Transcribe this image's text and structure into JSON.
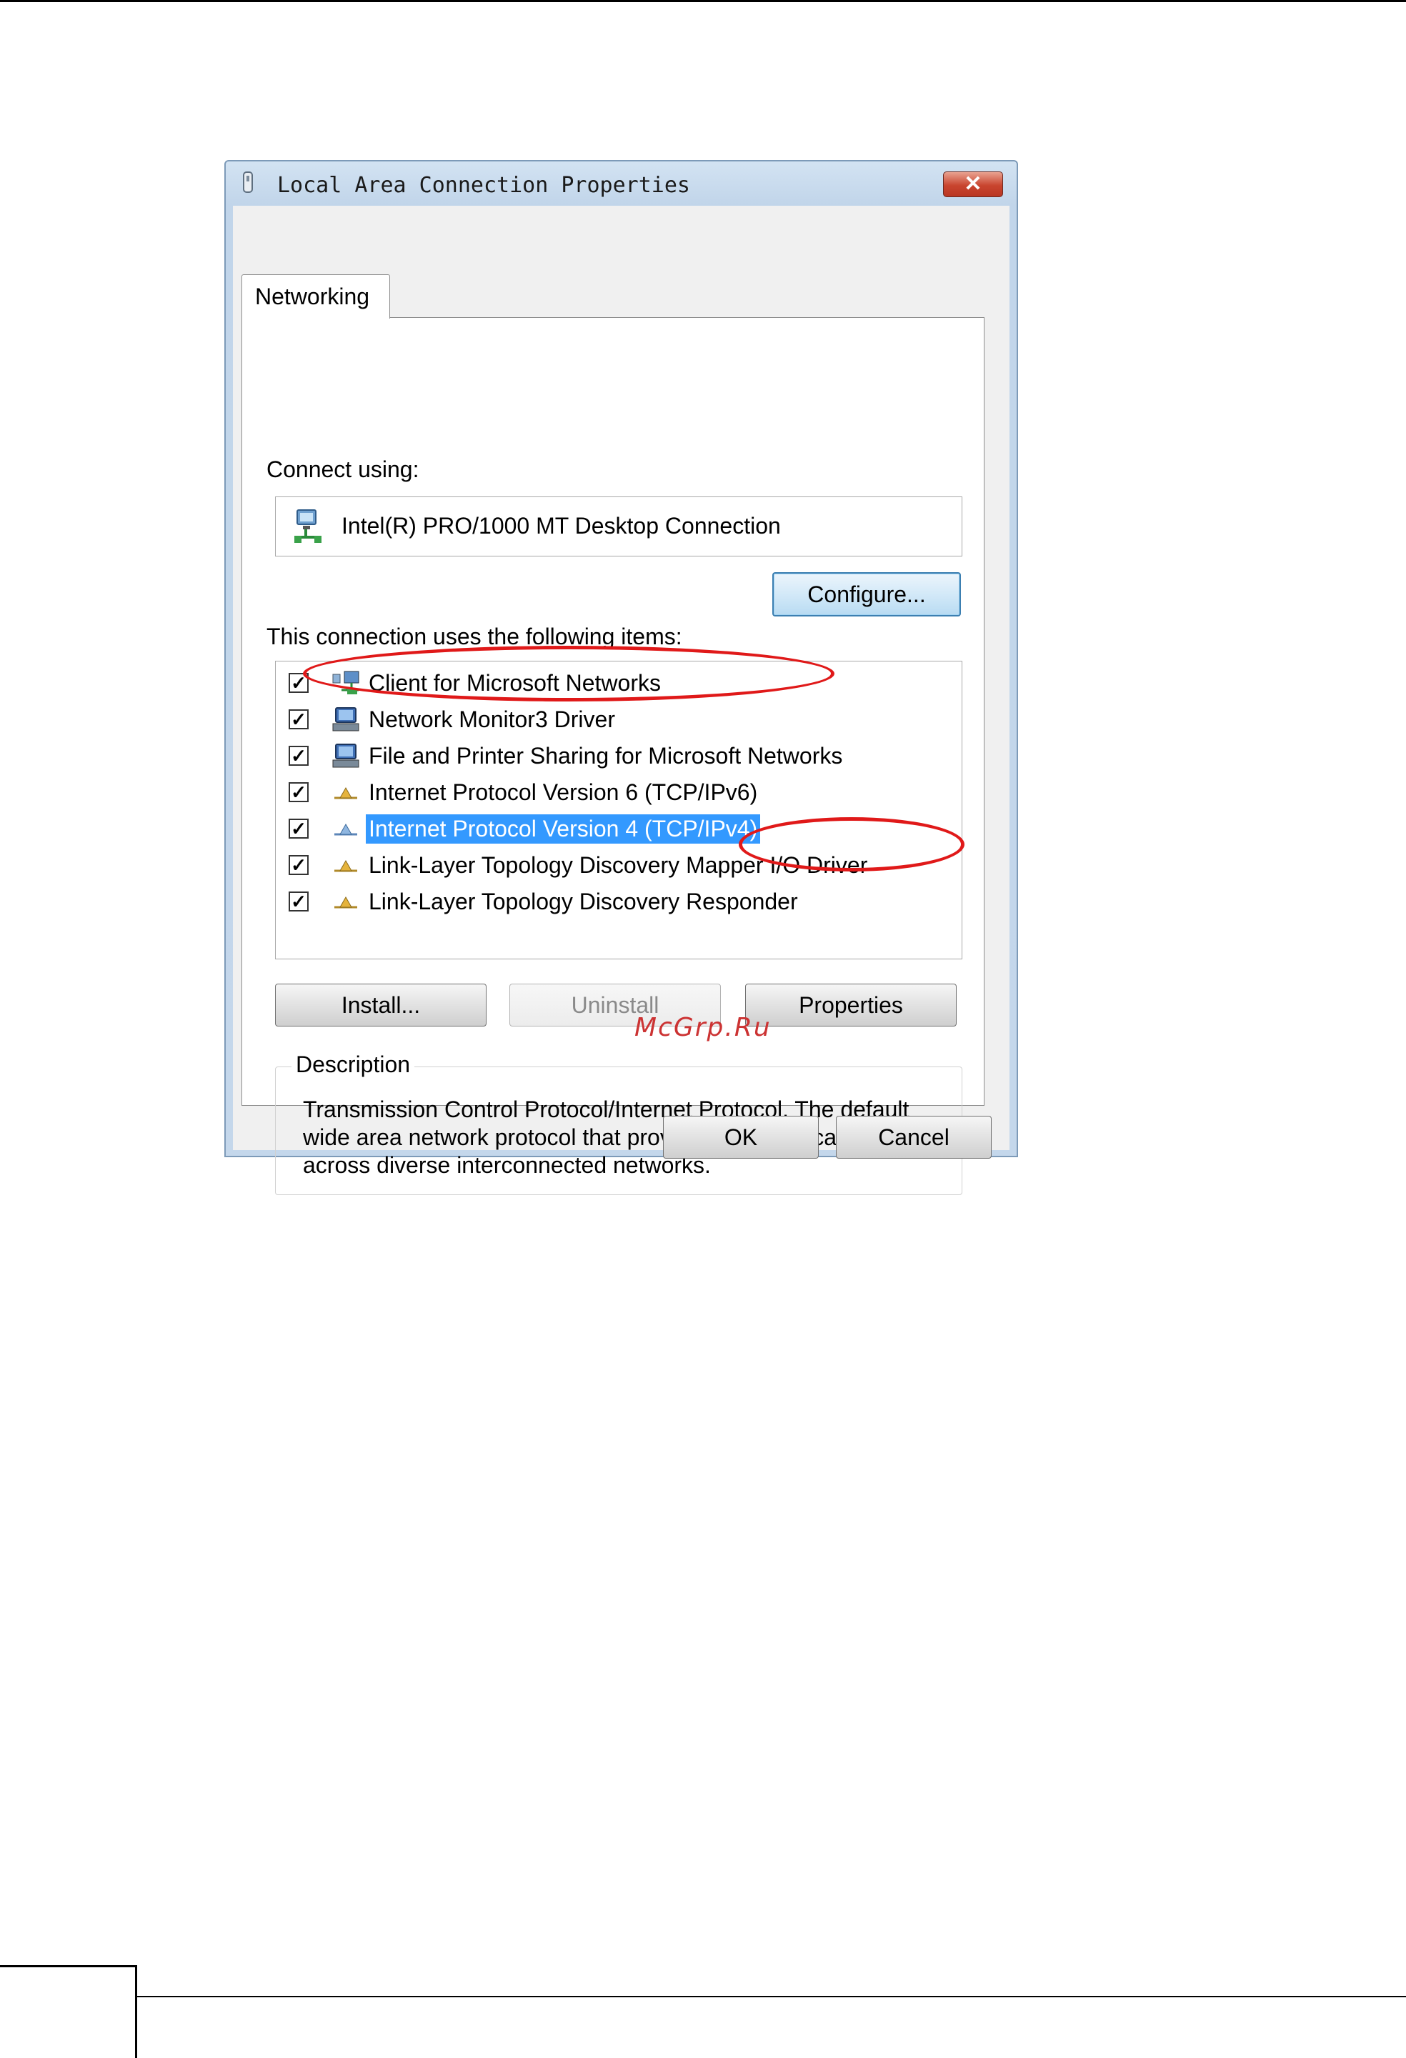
{
  "window": {
    "title": "Local Area Connection Properties",
    "close_glyph": "✕"
  },
  "tabs": [
    {
      "label": "Networking",
      "active": true
    }
  ],
  "connect_using": {
    "label": "Connect using:",
    "adapter": "Intel(R) PRO/1000 MT Desktop Connection",
    "configure_button": "Configure..."
  },
  "items_section": {
    "label": "This connection uses the following items:",
    "items": [
      {
        "label": "Client for Microsoft Networks",
        "checked": true,
        "icon": "client-network-icon",
        "selected": false
      },
      {
        "label": "Network Monitor3 Driver",
        "checked": true,
        "icon": "network-driver-icon",
        "selected": false
      },
      {
        "label": "File and Printer Sharing for Microsoft Networks",
        "checked": true,
        "icon": "file-printer-sharing-icon",
        "selected": false
      },
      {
        "label": "Internet Protocol Version 6 (TCP/IPv6)",
        "checked": true,
        "icon": "protocol-icon",
        "selected": false
      },
      {
        "label": "Internet Protocol Version 4 (TCP/IPv4)",
        "checked": true,
        "icon": "protocol-icon",
        "selected": true
      },
      {
        "label": "Link-Layer Topology Discovery Mapper I/O Driver",
        "checked": true,
        "icon": "protocol-icon",
        "selected": false
      },
      {
        "label": "Link-Layer Topology Discovery Responder",
        "checked": true,
        "icon": "protocol-icon",
        "selected": false
      }
    ]
  },
  "buttons": {
    "install": "Install...",
    "uninstall": "Uninstall",
    "properties": "Properties",
    "ok": "OK",
    "cancel": "Cancel"
  },
  "description": {
    "legend": "Description",
    "text": "Transmission Control Protocol/Internet Protocol. The default wide area network protocol that provides communication across diverse interconnected networks."
  },
  "watermark": "McGrp.Ru",
  "colors": {
    "selection": "#3399ff",
    "annotation": "#e01919",
    "titlebar": "#c1d5ea",
    "close_button": "#c9452f"
  }
}
